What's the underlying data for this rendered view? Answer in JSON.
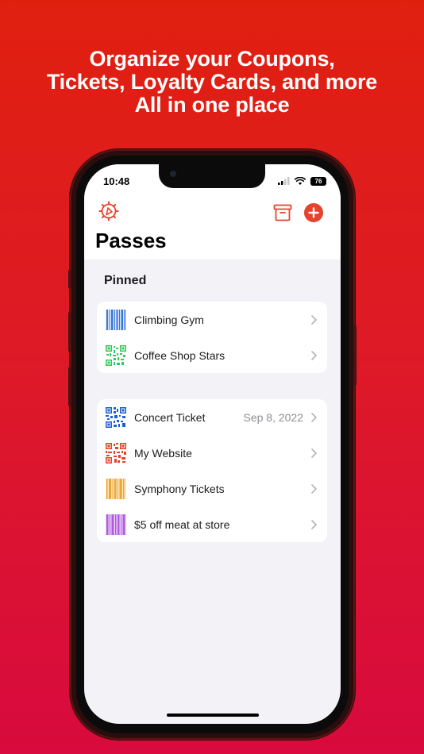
{
  "headline": {
    "line1": "Organize your Coupons,",
    "line2": "Tickets, Loyalty Cards, and more",
    "line3": "All in one place"
  },
  "status_bar": {
    "time": "10:48",
    "battery": "76"
  },
  "nav": {
    "title": "Passes"
  },
  "pinned": {
    "header": "Pinned",
    "items": [
      {
        "label": "Climbing Gym",
        "icon": "barcode-icon",
        "color": "#3b78d8"
      },
      {
        "label": "Coffee Shop Stars",
        "icon": "qr-code-icon",
        "color": "#34c759"
      }
    ]
  },
  "passes": {
    "items": [
      {
        "label": "Concert Ticket",
        "detail": "Sep 8, 2022",
        "icon": "qr-code-icon",
        "color": "#1a5fd0"
      },
      {
        "label": "My Website",
        "detail": "",
        "icon": "qr-code-icon",
        "color": "#e0442f"
      },
      {
        "label": "Symphony Tickets",
        "detail": "",
        "icon": "barcode-icon",
        "color": "#eea733"
      },
      {
        "label": "$5 off meat at store",
        "detail": "",
        "icon": "barcode-icon",
        "color": "#b35bdf"
      }
    ]
  },
  "colors": {
    "accent": "#e6432f",
    "background_top": "#e0200f",
    "background_bottom": "#d80a3e"
  }
}
